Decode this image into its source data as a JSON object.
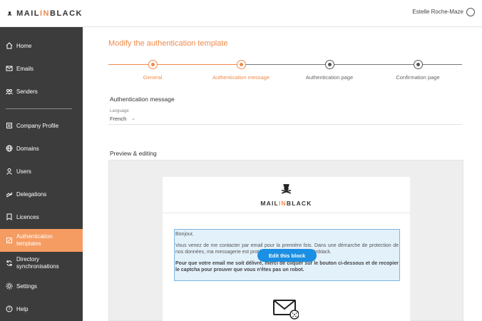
{
  "header": {
    "brand_part1": "MAIL",
    "brand_accent": "IN",
    "brand_part2": "BLACK",
    "user_name": "Estelle Roche-Maze"
  },
  "sidebar": {
    "items": [
      {
        "label": "Home",
        "icon": "home-icon"
      },
      {
        "label": "Emails",
        "icon": "mail-icon"
      },
      {
        "label": "Senders",
        "icon": "senders-icon"
      },
      {
        "label": "Company Profile",
        "icon": "company-icon"
      },
      {
        "label": "Domains",
        "icon": "globe-icon"
      },
      {
        "label": "Users",
        "icon": "user-icon"
      },
      {
        "label": "Delegations",
        "icon": "delegation-icon"
      },
      {
        "label": "Licences",
        "icon": "licence-icon"
      },
      {
        "label": "Authentication templates",
        "label_line1": "Authentication",
        "label_line2": "templates",
        "icon": "template-icon",
        "active": true
      },
      {
        "label": "Directory synchronisations",
        "label_line1": "Directory",
        "label_line2": "synchronisations",
        "icon": "sync-icon"
      },
      {
        "label": "Settings",
        "icon": "gear-icon"
      },
      {
        "label": "Help",
        "icon": "help-icon"
      }
    ]
  },
  "main": {
    "title": "Modify the authentication template",
    "steps": [
      {
        "label": "General",
        "state": "done"
      },
      {
        "label": "Authentication message",
        "state": "done"
      },
      {
        "label": "Authentication page",
        "state": "todo"
      },
      {
        "label": "Confirmation page",
        "state": "todo"
      }
    ],
    "auth_message_title": "Authentication message",
    "language_label": "Language",
    "language_value": "French",
    "preview_title": "Preview & editing",
    "email": {
      "brand_part1": "MAIL",
      "brand_accent": "IN",
      "brand_part2": "BLACK",
      "greeting": "Bonjour,",
      "paragraph1": "Vous venez de me contacter par email pour la première fois. Dans une démarche de protection de nos données, ma messagerie est protégée par l'anti-spam Mailinblack.",
      "paragraph2": "Pour que votre email me soit délivré, merci de cliquer sur le bouton ci-dessous et de recopier le captcha pour prouver que vous n'êtes pas un robot.",
      "edit_button": "Edit this block"
    }
  },
  "colors": {
    "accent": "#f08a4b",
    "sidebar_bg": "#3c3c3c",
    "sidebar_active": "#f59c62",
    "button_blue": "#1a8fe3"
  }
}
